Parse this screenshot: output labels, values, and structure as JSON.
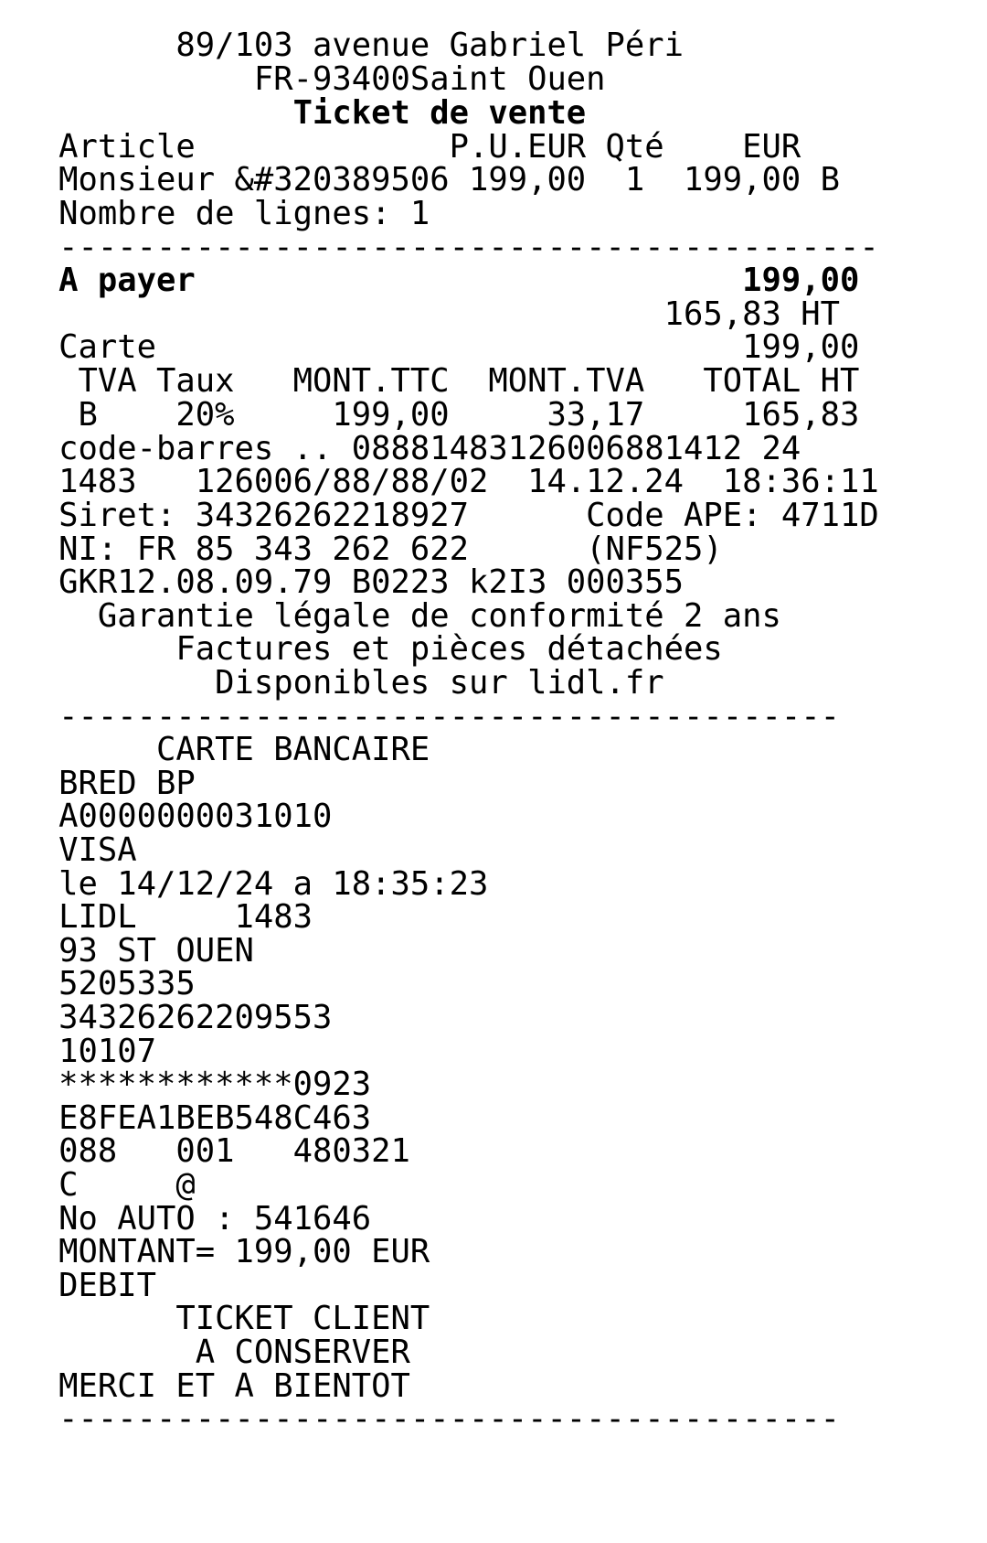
{
  "receipt": {
    "lines": [
      {
        "text": "         89/103 avenue Gabriel Péri",
        "bold": false
      },
      {
        "text": "             FR-93400Saint Ouen",
        "bold": false
      },
      {
        "text": "               Ticket de vente",
        "bold": true
      },
      {
        "text": "   Article             P.U.EUR Qté    EUR",
        "bold": false
      },
      {
        "text": "   Monsieur &#320389506 199,00  1  199,00 B",
        "bold": false
      },
      {
        "text": "   Nombre de lignes: 1",
        "bold": false
      },
      {
        "text": "   ------------------------------------------",
        "bold": false
      },
      {
        "text": "   A payer                            199,00",
        "bold": true
      },
      {
        "text": "                                  165,83 HT",
        "bold": false
      },
      {
        "text": "   Carte                              199,00",
        "bold": false
      },
      {
        "text": "    TVA Taux   MONT.TTC  MONT.TVA   TOTAL HT",
        "bold": false
      },
      {
        "text": "    B    20%     199,00     33,17     165,83",
        "bold": false
      },
      {
        "text": "   code-barres .. 08881483126006881412 24",
        "bold": false
      },
      {
        "text": "   1483   126006/88/88/02  14.12.24  18:36:11",
        "bold": false
      },
      {
        "text": "   Siret: 34326262218927      Code APE: 4711D",
        "bold": false
      },
      {
        "text": "   NI: FR 85 343 262 622      (NF525)",
        "bold": false
      },
      {
        "text": "   GKR12.08.09.79 B0223 k2I3 000355",
        "bold": false
      },
      {
        "text": "     Garantie légale de conformité 2 ans",
        "bold": false
      },
      {
        "text": "         Factures et pièces détachées",
        "bold": false
      },
      {
        "text": "           Disponibles sur lidl.fr",
        "bold": false
      },
      {
        "text": "   ----------------------------------------",
        "bold": false
      },
      {
        "text": "        CARTE BANCAIRE",
        "bold": false
      },
      {
        "text": "   BRED BP",
        "bold": false
      },
      {
        "text": "   A0000000031010",
        "bold": false
      },
      {
        "text": "   VISA",
        "bold": false
      },
      {
        "text": "   le 14/12/24 a 18:35:23",
        "bold": false
      },
      {
        "text": "   LIDL     1483",
        "bold": false
      },
      {
        "text": "   93 ST OUEN",
        "bold": false
      },
      {
        "text": "   5205335",
        "bold": false
      },
      {
        "text": "   34326262209553",
        "bold": false
      },
      {
        "text": "   10107",
        "bold": false
      },
      {
        "text": "   ************0923",
        "bold": false
      },
      {
        "text": "   E8FEA1BEB548C463",
        "bold": false
      },
      {
        "text": "   088   001   480321",
        "bold": false
      },
      {
        "text": "   C     @",
        "bold": false
      },
      {
        "text": "   No AUTO : 541646",
        "bold": false
      },
      {
        "text": "   MONTANT= 199,00 EUR",
        "bold": false
      },
      {
        "text": "   DEBIT",
        "bold": false
      },
      {
        "text": "         TICKET CLIENT",
        "bold": false
      },
      {
        "text": "          A CONSERVER",
        "bold": false
      },
      {
        "text": "   MERCI ET A BIENTOT",
        "bold": false
      },
      {
        "text": "   ----------------------------------------",
        "bold": false
      }
    ]
  }
}
